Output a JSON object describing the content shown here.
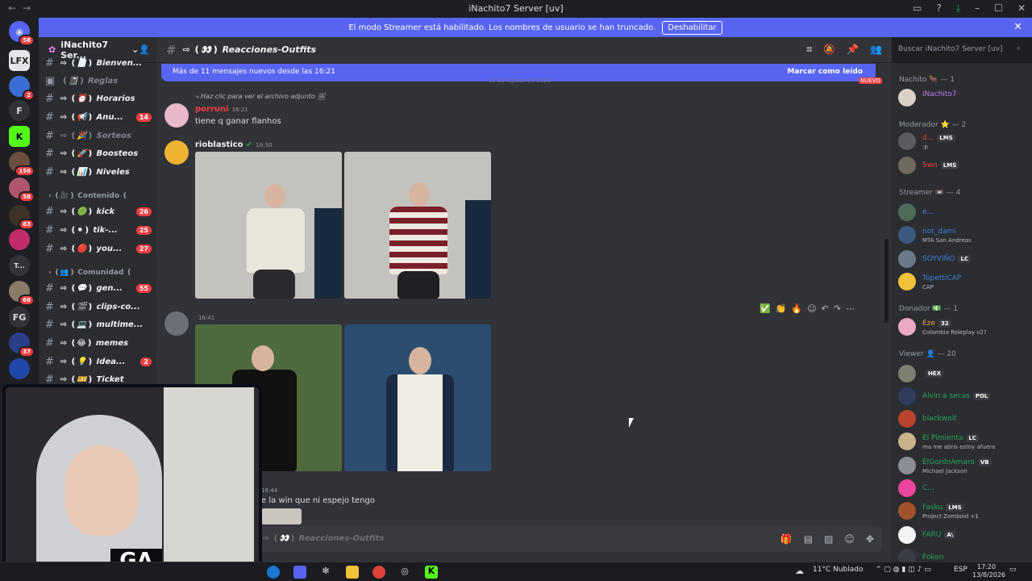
{
  "titlebar": {
    "title": "iNachito7 Server [uv]"
  },
  "banner": {
    "text": "El modo Streamer está habilitado. Los nombres de usuario se han truncado.",
    "button": "Deshabilitar"
  },
  "servers": [
    {
      "label": "",
      "badge": "58"
    },
    {
      "label": "LFX",
      "badge": ""
    },
    {
      "label": "",
      "badge": "2"
    },
    {
      "label": "F",
      "badge": ""
    },
    {
      "label": "K",
      "badge": ""
    },
    {
      "label": "",
      "badge": "156"
    },
    {
      "label": "",
      "badge": "58"
    },
    {
      "label": "",
      "badge": "83"
    },
    {
      "label": "",
      "badge": ""
    },
    {
      "label": "T...",
      "badge": ""
    },
    {
      "label": "",
      "badge": "66"
    },
    {
      "label": "FG",
      "badge": ""
    },
    {
      "label": "",
      "badge": "37"
    },
    {
      "label": "",
      "badge": ""
    }
  ],
  "sidebar": {
    "server_name": "iNachito7 Ser...",
    "channels": [
      {
        "name": "⇨ ❪📄❫ Bienven...",
        "badge": ""
      },
      {
        "name": "❪📓❫ Reglas",
        "badge": ""
      },
      {
        "name": "⇨ ❪⏰❫ Horarios",
        "badge": ""
      },
      {
        "name": "⇨ ❪📢❫ Anu...",
        "badge": "14"
      },
      {
        "name": "⇨ ❪🎉❫ Sorteos",
        "badge": ""
      },
      {
        "name": "⇨ ❪🚀❫ Boosteos",
        "badge": ""
      },
      {
        "name": "⇨ ❪📊❫ Niveles",
        "badge": ""
      },
      {
        "name": "⇨ ❪🟢❫ kick",
        "badge": "26"
      },
      {
        "name": "⇨ ❪⚫❫ tik-...",
        "badge": "25"
      },
      {
        "name": "⇨ ❪🔴❫ you...",
        "badge": "27"
      },
      {
        "name": "⇨ ❪💬❫ gen...",
        "badge": "55"
      },
      {
        "name": "⇨ ❪🎬❫ clips-co...",
        "badge": ""
      },
      {
        "name": "⇨ ❪💻❫ multime...",
        "badge": ""
      },
      {
        "name": "⇨ ❪😂❫ memes",
        "badge": ""
      },
      {
        "name": "⇨ ❪💡❫ Idea...",
        "badge": "2"
      },
      {
        "name": "⇨ ❪🎫❫ Ticket",
        "badge": ""
      }
    ],
    "categories": [
      "❪🎥❫ Contenido ❪",
      "❪👥❫ Comunidad ❪"
    ]
  },
  "chat": {
    "channel_title": "⇨ ❪👀❫ Reacciones-Outfits",
    "new_messages": "Más de 11 mensajes nuevos desde las 16:21",
    "mark_read": "Marcar como leído",
    "date_divider": "13 de agosto de 2026",
    "new_label": "NUEVO",
    "messages": [
      {
        "user": "porruni",
        "time": "16:21",
        "reply": "Haz clic para ver el archivo adjunto",
        "text": "tiene q ganar flanhos"
      },
      {
        "user": "rioblastico",
        "time": "16:30",
        "text": ""
      },
      {
        "user": "",
        "time": "16:41",
        "text": ""
      },
      {
        "user": "",
        "time": "16:44",
        "text": "e la win que ni espejo tengo"
      }
    ],
    "composer_placeholder": "⇨ ❪👀❫ Reacciones-Outfits",
    "reactions": [
      "✅",
      "👏",
      "🔥"
    ]
  },
  "search": {
    "placeholder": "Buscar iNachito7 Server [uv]"
  },
  "members": {
    "roles": [
      {
        "name": "Nachito 🐂 — 1"
      },
      {
        "name": "Moderador ⭐ — 2"
      },
      {
        "name": "Streamer 📼 — 4"
      },
      {
        "name": "Donador 💵 — 1"
      },
      {
        "name": "Viewer 👤 — 20"
      }
    ],
    "list": [
      {
        "name": "iNachito7",
        "tag": "",
        "sub": "",
        "color": "#c27cf2"
      },
      {
        "name": "d...",
        "tag": "LMS",
        "sub": ":p",
        "color": "#f23f43"
      },
      {
        "name": "Swn",
        "tag": "LMS",
        "sub": "",
        "color": "#f23f43"
      },
      {
        "name": "e...",
        "tag": "",
        "sub": "",
        "color": "#3e7fd5"
      },
      {
        "name": "not_dami",
        "tag": "",
        "sub": "MTA San Andreas",
        "color": "#3e7fd5"
      },
      {
        "name": "SOYVIÑO",
        "tag": "LC",
        "sub": "",
        "color": "#3e7fd5"
      },
      {
        "name": "TopettiCAP",
        "tag": "",
        "sub": "CAP",
        "color": "#3e7fd5"
      },
      {
        "name": "Eze",
        "tag": "32",
        "sub": "Colombia Roleplay v2?",
        "color": "#e8a23e"
      },
      {
        "name": "",
        "tag": "HEX",
        "sub": "",
        "color": "#23a55a"
      },
      {
        "name": "Alvin a secas",
        "tag": "POL",
        "sub": "",
        "color": "#23a55a"
      },
      {
        "name": "blackwolf",
        "tag": "",
        "sub": "",
        "color": "#23a55a"
      },
      {
        "name": "El Pimienta",
        "tag": "LC",
        "sub": "ma me abris estoy afuera",
        "color": "#23a55a"
      },
      {
        "name": "ElGordoAmaro",
        "tag": "VB",
        "sub": "Michael Jackson",
        "color": "#23a55a"
      },
      {
        "name": "C...",
        "tag": "",
        "sub": "",
        "color": "#23a55a"
      },
      {
        "name": "Fasku",
        "tag": "LMS",
        "sub": "Project Zomboid +1",
        "color": "#23a55a"
      },
      {
        "name": "FARU",
        "tag": "A\\",
        "sub": "",
        "color": "#23a55a"
      },
      {
        "name": "Foken",
        "tag": "",
        "sub": "",
        "color": "#23a55a"
      }
    ]
  },
  "webcam": {
    "text": "GA"
  },
  "taskbar": {
    "weather": "11°C  Nublado",
    "lang": "ESP",
    "time": "17:20",
    "date": "13/8/2026"
  }
}
